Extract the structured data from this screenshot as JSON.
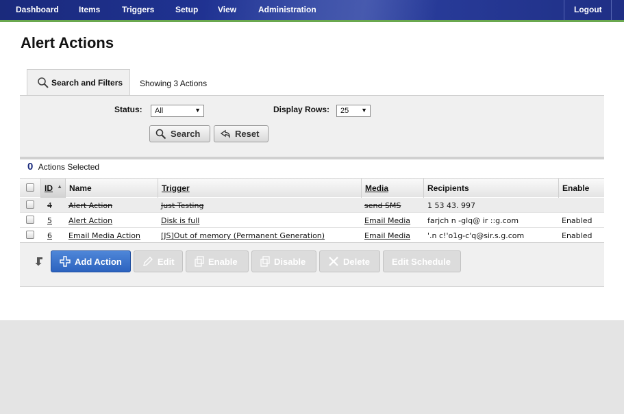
{
  "nav": {
    "items": [
      "Dashboard",
      "Items",
      "Triggers",
      "Setup",
      "View",
      "Administration"
    ],
    "logout": "Logout"
  },
  "page": {
    "title": "Alert Actions"
  },
  "tabs": {
    "search_filters": "Search and Filters",
    "showing": "Showing 3 Actions"
  },
  "filters": {
    "status_label": "Status:",
    "status_value": "All",
    "rows_label": "Display Rows:",
    "rows_value": "25",
    "search_button": "Search",
    "reset_button": "Reset"
  },
  "selection": {
    "count": "0",
    "label": "Actions Selected"
  },
  "table": {
    "columns": [
      "ID",
      "Name",
      "Trigger",
      "Media",
      "Recipients",
      "Enable"
    ],
    "rows": [
      {
        "id": "4",
        "name": "Alert Action",
        "trigger": "Just Testing",
        "media": "send SMS",
        "recipients": "1 53 43. 997",
        "enable": "",
        "disabled": true
      },
      {
        "id": "5",
        "name": "Alert Action",
        "trigger": "Disk is full",
        "media": "Email Media",
        "recipients": "farjch n -glq@ ir ::g.com",
        "enable": "Enabled",
        "disabled": false
      },
      {
        "id": "6",
        "name": "Email Media Action",
        "trigger": "[JS]Out of memory (Permanent Generation)",
        "media": "Email Media",
        "recipients": "'.n c!'o1g-c'q@sir.s.g.com",
        "enable": "Enabled",
        "disabled": false
      }
    ]
  },
  "actions": {
    "add": "Add Action",
    "edit": "Edit",
    "enable": "Enable",
    "disable": "Disable",
    "delete": "Delete",
    "schedule": "Edit Schedule"
  },
  "colors": {
    "nav_bg": "#203393",
    "nav_accent": "#6aa84f",
    "primary_button": "#2c63bf"
  }
}
